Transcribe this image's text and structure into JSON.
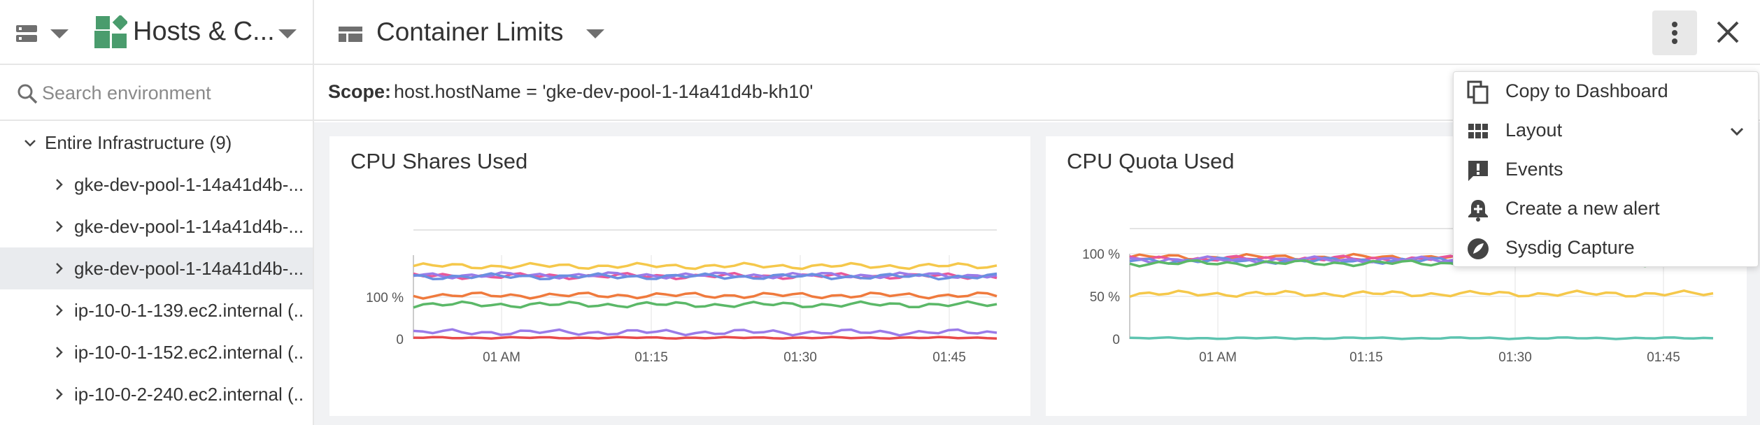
{
  "header": {
    "hosts_title": "Hosts & C...",
    "dashboard_title": "Container Limits"
  },
  "sidebar": {
    "search_placeholder": "Search environment",
    "root": {
      "label": "Entire Infrastructure (9)"
    },
    "items": [
      {
        "label": "gke-dev-pool-1-14a41d4b-..."
      },
      {
        "label": "gke-dev-pool-1-14a41d4b-..."
      },
      {
        "label": "gke-dev-pool-1-14a41d4b-..."
      },
      {
        "label": "ip-10-0-1-139.ec2.internal (..."
      },
      {
        "label": "ip-10-0-1-152.ec2.internal (..."
      },
      {
        "label": "ip-10-0-2-240.ec2.internal (..."
      }
    ],
    "selected_index": 2
  },
  "scope": {
    "label": "Scope:",
    "value": "host.hostName = 'gke-dev-pool-1-14a41d4b-kh10'"
  },
  "menu": {
    "items": [
      {
        "label": "Copy to Dashboard",
        "icon": "copy-icon"
      },
      {
        "label": "Layout",
        "icon": "layout-grid-icon"
      },
      {
        "label": "Events",
        "icon": "events-icon"
      },
      {
        "label": "Create a new alert",
        "icon": "alert-bell-icon"
      },
      {
        "label": "Sysdig Capture",
        "icon": "capture-icon"
      }
    ]
  },
  "colors": {
    "accent_green": "#4a9c6d",
    "yellow": "#f5c84b",
    "pink": "#e8579a",
    "purple": "#9a7be8",
    "blue": "#6a8fe0",
    "orange": "#ef7a3d",
    "green": "#5bb868",
    "red": "#e84a4a",
    "teal": "#5ec4b0"
  },
  "chart_data": [
    {
      "type": "line",
      "title": "CPU Shares Used",
      "x_ticks": [
        "01 AM",
        "01:15",
        "01:30",
        "01:45"
      ],
      "y_ticks": [
        "0",
        "100 %"
      ],
      "ylim": [
        0,
        200
      ],
      "grid": true,
      "series": [
        {
          "color": "#f5c84b",
          "level": 174
        },
        {
          "color": "#e8579a",
          "level": 150
        },
        {
          "color": "#9a7be8",
          "level": 152
        },
        {
          "color": "#6a8fe0",
          "level": 149
        },
        {
          "color": "#ef7a3d",
          "level": 104
        },
        {
          "color": "#5bb868",
          "level": 82
        },
        {
          "color": "#9a7be8",
          "level": 16
        },
        {
          "color": "#e84a4a",
          "level": 3
        }
      ]
    },
    {
      "type": "line",
      "title": "CPU Quota Used",
      "x_ticks": [
        "01 AM",
        "01:15",
        "01:30",
        "01:45"
      ],
      "y_ticks": [
        "0",
        "50 %",
        "100 %"
      ],
      "ylim": [
        0,
        100
      ],
      "grid": true,
      "series": [
        {
          "color": "#ef7a3d",
          "level": 96
        },
        {
          "color": "#e8579a",
          "level": 94
        },
        {
          "color": "#6a8fe0",
          "level": 92
        },
        {
          "color": "#9a7be8",
          "level": 93
        },
        {
          "color": "#5bb868",
          "level": 89
        },
        {
          "color": "#f5c84b",
          "level": 53
        },
        {
          "color": "#5ec4b0",
          "level": 1
        }
      ]
    }
  ]
}
